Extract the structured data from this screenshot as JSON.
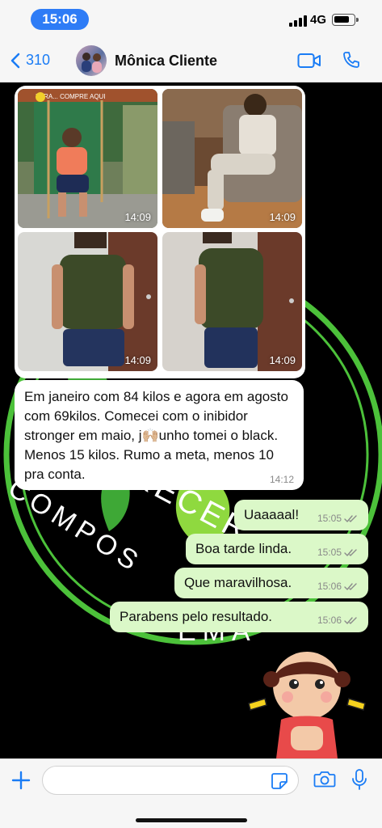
{
  "status_bar": {
    "time": "15:06",
    "network": "4G",
    "battery_level": 0.8
  },
  "header": {
    "back_count": "310",
    "contact_name": "Mônica Cliente"
  },
  "wallpaper": {
    "text_right": "RECER",
    "text_left": "COMPOS",
    "text_bottom": "EMA",
    "accent_color": "#4cc13a"
  },
  "photos": [
    {
      "time": "14:09",
      "alt_text": "PARA... COMPRE AQUI"
    },
    {
      "time": "14:09"
    },
    {
      "time": "14:09"
    },
    {
      "time": "14:09"
    }
  ],
  "incoming_message": {
    "text": "Em janeiro com 84 kilos e agora em agosto com 69kilos. Comecei com o inibidor stronger em maio, j🙌🏼unho tomei o black. Menos 15 kilos. Rumo a meta, menos 10 pra conta.",
    "time": "14:12"
  },
  "outgoing_messages": [
    {
      "text": "Uaaaaal!",
      "time": "15:05"
    },
    {
      "text": "Boa tarde linda.",
      "time": "15:05"
    },
    {
      "text": "Que maravilhosa.",
      "time": "15:06"
    },
    {
      "text": "Parabens pelo resultado.",
      "time": "15:06"
    }
  ],
  "composer": {
    "placeholder": ""
  },
  "colors": {
    "accent": "#1a7cf5",
    "outgoing_bubble": "#dbf8c8",
    "time_pill": "#2e7cf6"
  }
}
